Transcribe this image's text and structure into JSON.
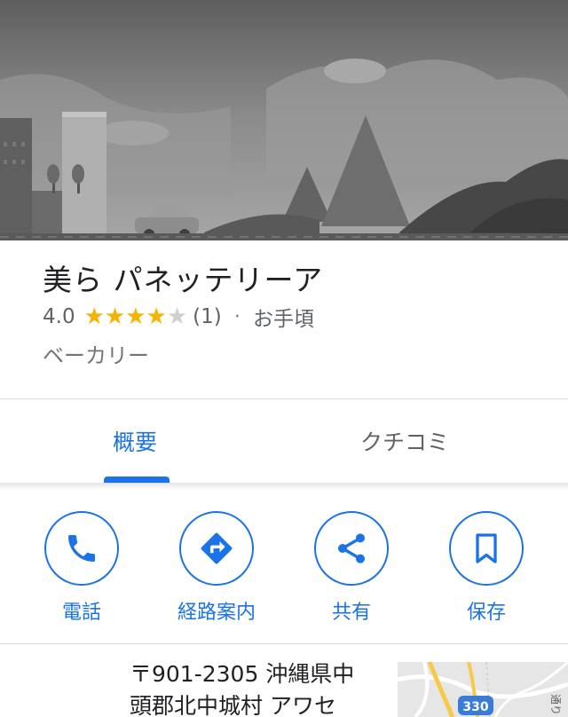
{
  "place": {
    "name": "美ら パネッテリーア",
    "rating": "4.0",
    "rating_stars": 4,
    "stars_total": 5,
    "review_count": "(1)",
    "separator": "·",
    "price_level": "お手頃",
    "category": "ベーカリー"
  },
  "tabs": [
    {
      "label": "概要",
      "active": true
    },
    {
      "label": "クチコミ",
      "active": false
    }
  ],
  "actions": [
    {
      "label": "電話",
      "icon": "phone-icon"
    },
    {
      "label": "経路案内",
      "icon": "directions-icon"
    },
    {
      "label": "共有",
      "icon": "share-icon"
    },
    {
      "label": "保存",
      "icon": "bookmark-icon"
    }
  ],
  "address": {
    "line1": "〒901-2305 沖縄県中",
    "line2": "頭郡北中城村 アワセ"
  },
  "map": {
    "route_number": "330",
    "road_label": "通り"
  },
  "colors": {
    "accent": "#1a73e8",
    "star": "#f4b400"
  }
}
